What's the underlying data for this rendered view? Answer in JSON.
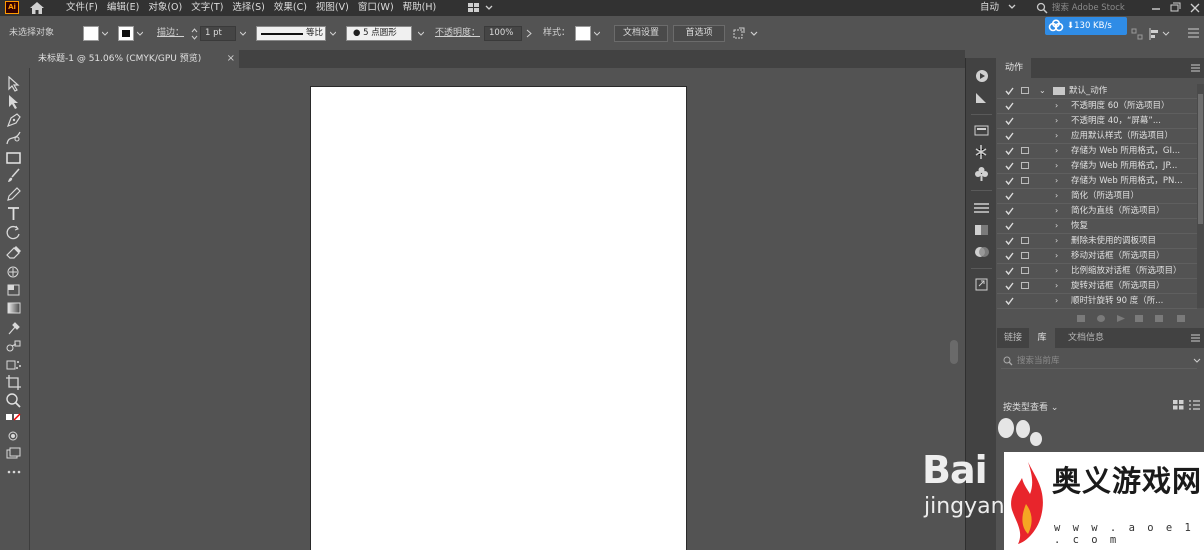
{
  "menubar": {
    "logo": "Ai",
    "menus": [
      "文件(F)",
      "编辑(E)",
      "对象(O)",
      "文字(T)",
      "选择(S)",
      "效果(C)",
      "视图(V)",
      "窗口(W)",
      "帮助(H)"
    ],
    "workspace": "自动",
    "stock_search_placeholder": "搜索 Adobe Stock"
  },
  "control_bar": {
    "selection_status": "未选择对象",
    "stroke_label": "描边：",
    "stroke_weight": "1 pt",
    "stroke_profile_label": "等比",
    "brush_label": "5 点圆形",
    "opacity_label": "不透明度：",
    "opacity_value": "100%",
    "style_label": "样式：",
    "doc_setup_button": "文档设置",
    "preferences_button": "首选项",
    "cloud_speed": "130 KB/s"
  },
  "document": {
    "tab_title": "未标题-1 @ 51.06% (CMYK/GPU 预览)",
    "close_glyph": "×"
  },
  "actions_panel": {
    "tab": "动作",
    "rows": [
      {
        "label": "默认_动作",
        "folder": true,
        "dialog": true
      },
      {
        "label": "不透明度 60（所选项目）",
        "dialog": false
      },
      {
        "label": "不透明度 40，“屏幕”...",
        "dialog": false
      },
      {
        "label": "应用默认样式（所选项目）",
        "dialog": false
      },
      {
        "label": "存储为 Web 所用格式，GI...",
        "dialog": true
      },
      {
        "label": "存储为 Web 所用格式，JP...",
        "dialog": true
      },
      {
        "label": "存储为 Web 所用格式，PN...",
        "dialog": true
      },
      {
        "label": "简化（所选项目）",
        "dialog": false
      },
      {
        "label": "简化为直线（所选项目）",
        "dialog": false
      },
      {
        "label": "恢复",
        "dialog": false
      },
      {
        "label": "删除未使用的调板项目",
        "dialog": true
      },
      {
        "label": "移动对话框（所选项目）",
        "dialog": true
      },
      {
        "label": "比例缩放对话框（所选项目）",
        "dialog": true
      },
      {
        "label": "旋转对话框（所选项目）",
        "dialog": true
      },
      {
        "label": "顺时针旋转 90 度（所...",
        "dialog": false
      }
    ]
  },
  "library_panel": {
    "tabs": [
      "链接",
      "库",
      "文档信息"
    ],
    "active_tab": "库",
    "search_placeholder": "搜索当前库",
    "sort_label": "按类型查看"
  },
  "watermarks": {
    "baidu_text": "Bai",
    "baidu_sub": "jingyan",
    "site_name": "奥义游戏网",
    "site_url": "w w w . a o e 1 . c o m"
  },
  "colors": {
    "ui_dark": "#323232",
    "ui_mid": "#535353",
    "panel_header": "#424242",
    "accent": "#2f8ce6",
    "ai_orange": "#ff9a00"
  }
}
